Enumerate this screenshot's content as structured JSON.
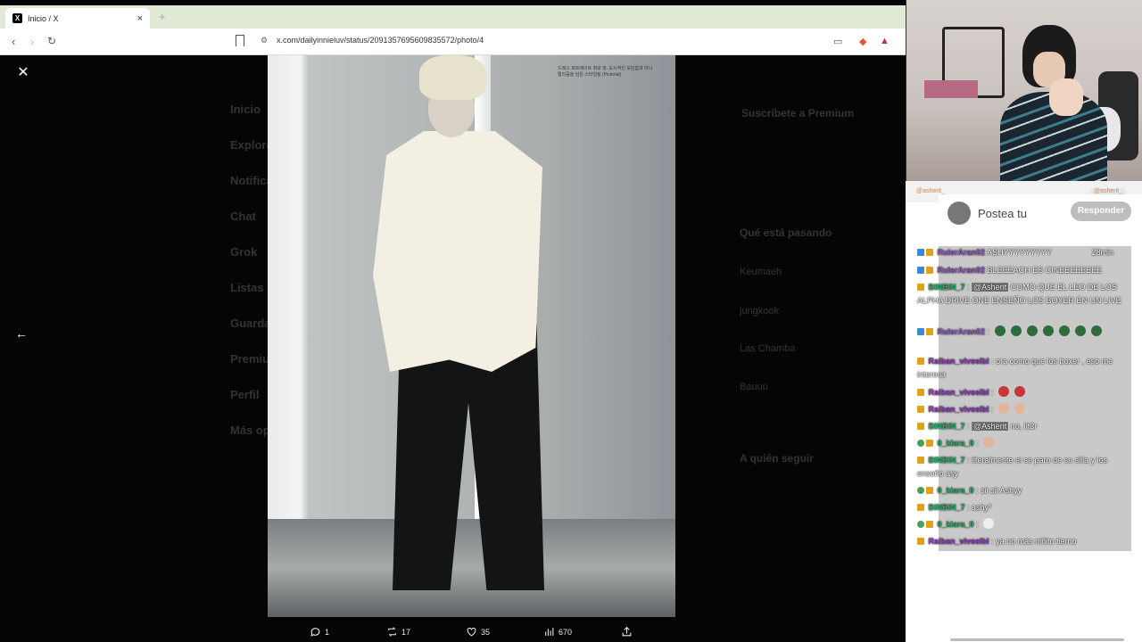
{
  "browser": {
    "tab_title": "Inicio / X",
    "tab_favicon": "X",
    "new_tab_glyph": "+",
    "url": "x.com/dailyinnieluv/status/2091357695609835572/photo/4"
  },
  "background_nav": [
    "Inicio",
    "Explorar",
    "Notificaciones",
    "Chat",
    "Grok",
    "Listas",
    "Guardados",
    "Perfil",
    "Premium",
    "Más opciones"
  ],
  "background_right": {
    "premium_title": "Suscríbete a Premium",
    "trends_title": "Qué está pasando",
    "trend_1": "Keumaeh",
    "trend_2": "jungkook",
    "trend_3": "Las Chamba",
    "trend_4": "Bauuu",
    "follow_title": "A quién seguir"
  },
  "photo": {
    "caption": "드레스 포트레이트 화보 컷. 도시적인 모던함과 미니멀리즘을 담은 스타일링 (Pictorial)"
  },
  "actions": {
    "replies": "1",
    "reposts": "17",
    "likes": "35",
    "views": "670"
  },
  "overlay": {
    "tag_left": "@asherit_",
    "tag_right": "@asherit_",
    "reply_placeholder": "Postea tu",
    "reply_button": "Responder"
  },
  "chat": [
    {
      "user": "RulerAran02",
      "color": "purple",
      "text": "ASHYYYYYYYYY",
      "time": "28min"
    },
    {
      "user": "RulerAran02",
      "color": "purple",
      "text": "BLEEEACH ES CINEEEEEEEE"
    },
    {
      "user": "BINBIN_7",
      "color": "green",
      "mention": "@Asherit",
      "text": "COMO QUE EL LEO DE LOS ALPHA DRIVE ONE ENSEÑO LOS BOXER EN UN LIVE"
    },
    {
      "user": "RulerAran02",
      "color": "purple",
      "text": ""
    },
    {
      "user": "Raiban_viveelbl",
      "color": "pink",
      "text": "ora como que los boxer , eso me interesa"
    },
    {
      "user": "Raiban_viveelbl",
      "color": "pink",
      "text": ""
    },
    {
      "user": "Raiban_viveelbl",
      "color": "pink",
      "text": ""
    },
    {
      "user": "BINBIN_7",
      "color": "green",
      "mention": "@Asherit",
      "text": "no, lit3r"
    },
    {
      "user": "0_kiara_0",
      "color": "green",
      "text": ""
    },
    {
      "user": "BINBIN_7",
      "color": "green",
      "text": "literalmente el se paro de su silla y los enseño asy"
    },
    {
      "user": "0_kiara_0",
      "color": "green",
      "text": "sii sii Ashyy"
    },
    {
      "user": "BINBIN_7",
      "color": "green",
      "text": "ashy*"
    },
    {
      "user": "0_kiara_0",
      "color": "green",
      "text": ""
    },
    {
      "user": "Raiban_viveelbl",
      "color": "pink",
      "text": "ya no más niñito tierno"
    }
  ],
  "colors": {
    "tabbar": "#dfe9d6",
    "chat_bg": "#c9c9c9",
    "username_purple": "#9b59d0",
    "username_green": "#2db36a",
    "username_pink": "#9b3fc9"
  }
}
